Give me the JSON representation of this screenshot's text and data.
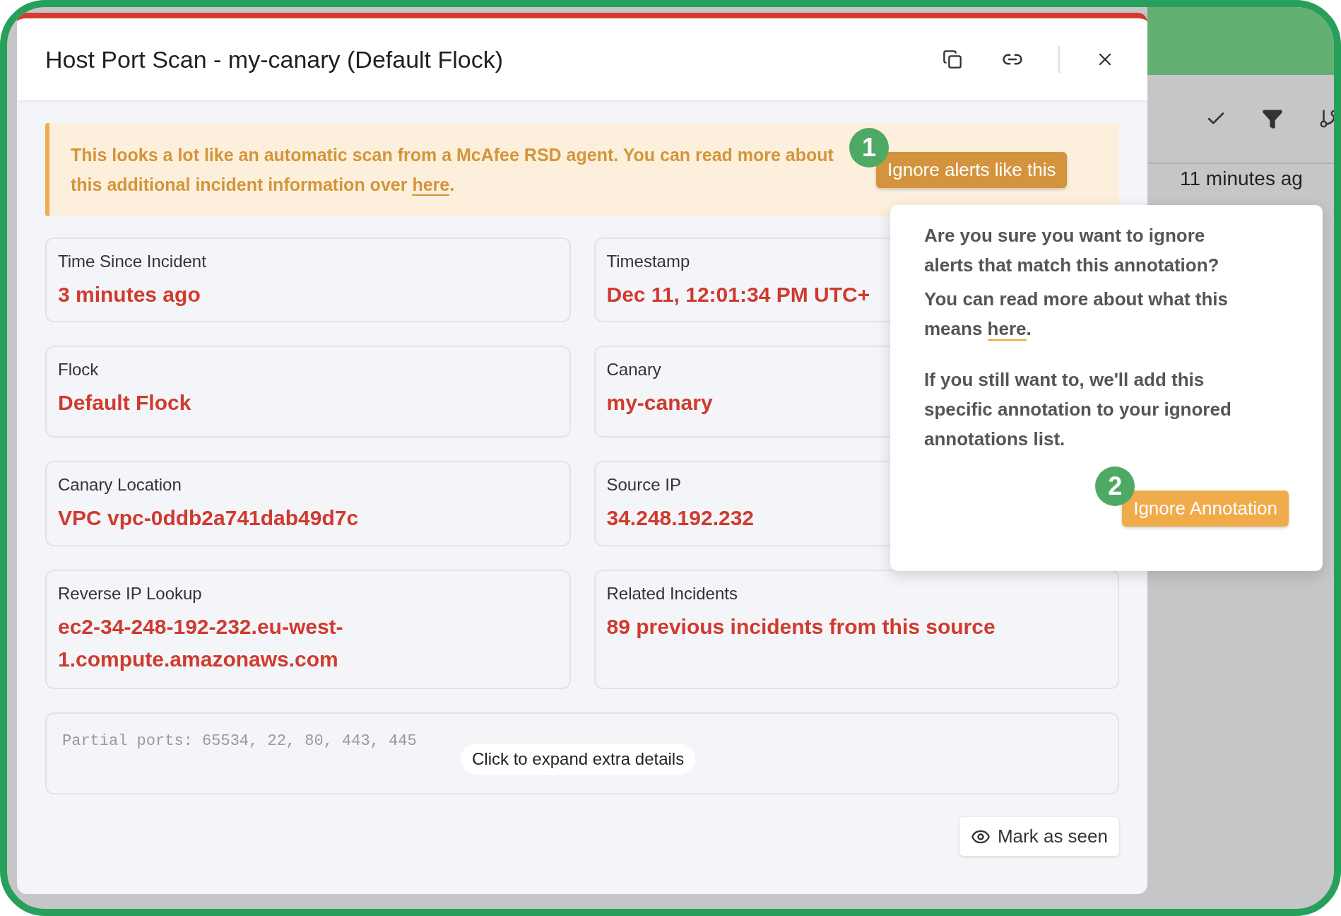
{
  "modal": {
    "title": "Host Port Scan - my-canary (Default Flock)"
  },
  "banner": {
    "text_before": "This looks a lot like an automatic scan from a McAfee RSD agent. You can read more about this additional incident information over ",
    "link": "here",
    "text_after": ".",
    "button": "Ignore alerts like this",
    "step": "1"
  },
  "fields": [
    {
      "label": "Time Since Incident",
      "value": "3 minutes ago"
    },
    {
      "label": "Timestamp",
      "value": "Dec 11, 12:01:34 PM UTC+"
    },
    {
      "label": "Flock",
      "value": "Default Flock"
    },
    {
      "label": "Canary",
      "value": "my-canary"
    },
    {
      "label": "Canary Location",
      "value": "VPC vpc-0ddb2a741dab49d7c"
    },
    {
      "label": "Source IP",
      "value": "34.248.192.232"
    },
    {
      "label": "Reverse IP Lookup",
      "value": "ec2-34-248-192-232.eu-west-1.compute.amazonaws.com"
    },
    {
      "label": "Related Incidents",
      "value": "89 previous incidents from this source"
    }
  ],
  "ports": {
    "text": "Partial ports: 65534, 22, 80, 443, 445",
    "expand": "Click to expand extra details"
  },
  "mark_seen": "Mark as seen",
  "popover": {
    "question": "Are you sure you want to ignore alerts that match this annotation?",
    "info_before": "You can read more about what this means ",
    "info_link": "here",
    "info_after": ".",
    "note": "If you still want to, we'll add this specific annotation to your ignored annotations list.",
    "button": "Ignore Annotation",
    "step": "2"
  },
  "background": {
    "time": "11 minutes ag"
  }
}
